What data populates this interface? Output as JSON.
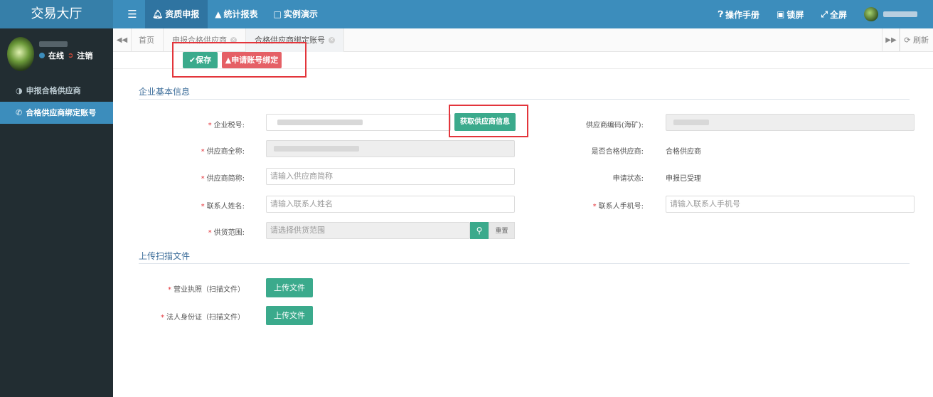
{
  "header": {
    "brand": "交易大厅",
    "nav": [
      {
        "label": "资质申报",
        "icon": "bell-icon"
      },
      {
        "label": "统计报表",
        "icon": "area-chart-icon"
      },
      {
        "label": "实例演示",
        "icon": "monitor-icon"
      }
    ],
    "right": {
      "manual": "操作手册",
      "lock": "锁屏",
      "fullscreen": "全屏"
    }
  },
  "sidebar": {
    "status_online": "在线",
    "logout": "注销",
    "items": [
      {
        "label": "申报合格供应商",
        "icon": "half-circle-icon"
      },
      {
        "label": "合格供应商绑定账号",
        "icon": "phone-icon"
      }
    ]
  },
  "tabs": {
    "items": [
      {
        "label": "首页"
      },
      {
        "label": "申报合格供应商"
      },
      {
        "label": "合格供应商绑定账号"
      }
    ],
    "refresh": "刷新"
  },
  "toolbar": {
    "save": "保存",
    "apply": "申请账号绑定"
  },
  "section_basic": {
    "title": "企业基本信息",
    "tax_no_label": "企业税号:",
    "fetch_button": "获取供应商信息",
    "supplier_code_label": "供应商编码(海矿):",
    "full_name_label": "供应商全称:",
    "is_qualified_label": "是否合格供应商:",
    "is_qualified_value": "合格供应商",
    "short_name_label": "供应商简称:",
    "short_name_placeholder": "请输入供应商简称",
    "apply_status_label": "申请状态:",
    "apply_status_value": "申报已受理",
    "contact_name_label": "联系人姓名:",
    "contact_name_placeholder": "请输入联系人姓名",
    "contact_phone_label": "联系人手机号:",
    "contact_phone_placeholder": "请输入联系人手机号",
    "supply_scope_label": "供货范围:",
    "supply_scope_placeholder": "请选择供货范围",
    "clear_button": "重置"
  },
  "section_upload": {
    "title": "上传扫描文件",
    "license_label": "营业执照（扫描文件）",
    "id_label": "法人身份证（扫描文件）",
    "upload_button": "上传文件"
  }
}
